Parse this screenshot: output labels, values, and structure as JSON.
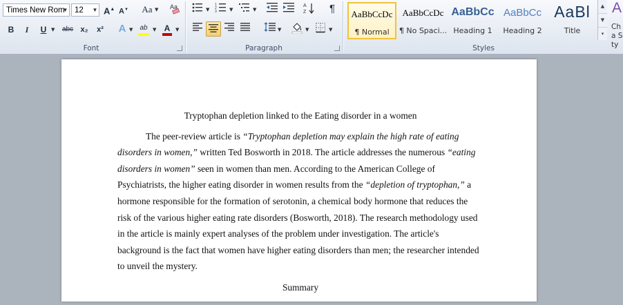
{
  "ribbon": {
    "font": {
      "group_label": "Font",
      "font_name": "Times New Rom",
      "font_size": "12",
      "grow_label": "A",
      "shrink_label": "A",
      "change_case_label": "Aa",
      "bold_label": "B",
      "italic_label": "I",
      "underline_label": "U",
      "strike_label": "abc",
      "subscript_label": "x₂",
      "superscript_label": "x²",
      "text_effects_label": "A",
      "highlight_label": "ab",
      "font_color_label": "A"
    },
    "paragraph": {
      "group_label": "Paragraph",
      "pilcrow_label": "¶"
    },
    "styles": {
      "group_label": "Styles",
      "items": [
        {
          "sample": "AaBbCcDc",
          "name": "¶ Normal"
        },
        {
          "sample": "AaBbCcDc",
          "name": "¶ No Spaci..."
        },
        {
          "sample": "AaBbCc",
          "name": "Heading 1"
        },
        {
          "sample": "AaBbCc",
          "name": "Heading 2"
        },
        {
          "sample": "AaBl",
          "name": "Title"
        }
      ],
      "change_styles_label": "Cha Sty"
    },
    "colors": {
      "heading_blue": "#365f91",
      "heading2_blue": "#4f81bd",
      "highlight_yellow": "#ffff00",
      "font_red": "#c00000",
      "selected_gold": "#f0c23a"
    }
  },
  "document": {
    "title": "Tryptophan depletion linked to the Eating disorder in a women",
    "para_parts": [
      "The peer-review article is ",
      "“Tryptophan depletion may explain the high rate of eating disorders in women,”",
      " written Ted Bosworth in 2018. The article addresses the numerous ",
      "“eating disorders in women”",
      " seen in women than men. According to the American College of Psychiatrists, the higher eating disorder in women results from the ",
      "“depletion of tryptophan,”",
      " a hormone responsible for the formation of serotonin, a chemical body hormone that reduces the risk of the various higher eating rate disorders (Bosworth, 2018). The research methodology used in the article is mainly expert analyses of the problem under investigation. The article's background is the fact that women have higher eating disorders than men; the researcher intended to unveil the mystery."
    ],
    "summary_heading": "Summary"
  }
}
